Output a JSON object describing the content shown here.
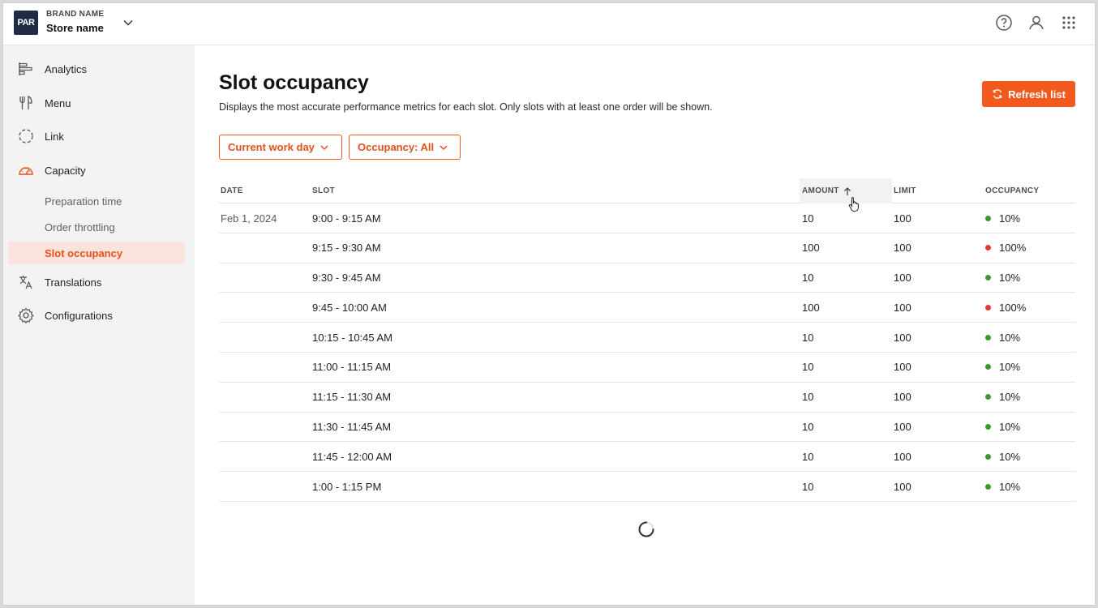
{
  "header": {
    "logo_text": "PAR",
    "brand_label": "BRAND NAME",
    "store_name": "Store name"
  },
  "sidebar": {
    "items": [
      {
        "label": "Analytics",
        "icon": "analytics-icon"
      },
      {
        "label": "Menu",
        "icon": "fork-knife-icon"
      },
      {
        "label": "Link",
        "icon": "link-circle-icon"
      },
      {
        "label": "Capacity",
        "icon": "gauge-icon"
      },
      {
        "label": "Translations",
        "icon": "translate-icon"
      },
      {
        "label": "Configurations",
        "icon": "gear-icon"
      }
    ],
    "capacity_sub": [
      {
        "label": "Preparation time"
      },
      {
        "label": "Order throttling"
      },
      {
        "label": "Slot occupancy"
      }
    ]
  },
  "main": {
    "title": "Slot occupancy",
    "description": "Displays the most accurate performance metrics for each slot. Only slots with at least one order will be shown.",
    "refresh_label": "Refresh list",
    "filters": {
      "date_label": "Current work day",
      "occupancy_label": "Occupancy: All"
    },
    "table": {
      "headers": {
        "date": "DATE",
        "slot": "SLOT",
        "amount": "AMOUNT",
        "limit": "LIMIT",
        "occupancy": "OCCUPANCY"
      },
      "rows": [
        {
          "date": "Feb 1, 2024",
          "slot": "9:00 - 9:15 AM",
          "amount": "10",
          "limit": "100",
          "occupancy": "10%",
          "status": "green"
        },
        {
          "date": "",
          "slot": "9:15 - 9:30 AM",
          "amount": "100",
          "limit": "100",
          "occupancy": "100%",
          "status": "red"
        },
        {
          "date": "",
          "slot": "9:30 - 9:45 AM",
          "amount": "10",
          "limit": "100",
          "occupancy": "10%",
          "status": "green"
        },
        {
          "date": "",
          "slot": "9:45 - 10:00 AM",
          "amount": "100",
          "limit": "100",
          "occupancy": "100%",
          "status": "red"
        },
        {
          "date": "",
          "slot": "10:15 - 10:45 AM",
          "amount": "10",
          "limit": "100",
          "occupancy": "10%",
          "status": "green"
        },
        {
          "date": "",
          "slot": "11:00 - 11:15 AM",
          "amount": "10",
          "limit": "100",
          "occupancy": "10%",
          "status": "green"
        },
        {
          "date": "",
          "slot": "11:15 - 11:30 AM",
          "amount": "10",
          "limit": "100",
          "occupancy": "10%",
          "status": "green"
        },
        {
          "date": "",
          "slot": "11:30 - 11:45 AM",
          "amount": "10",
          "limit": "100",
          "occupancy": "10%",
          "status": "green"
        },
        {
          "date": "",
          "slot": "11:45 - 12:00 AM",
          "amount": "10",
          "limit": "100",
          "occupancy": "10%",
          "status": "green"
        },
        {
          "date": "",
          "slot": "1:00 - 1:15 PM",
          "amount": "10",
          "limit": "100",
          "occupancy": "10%",
          "status": "green"
        }
      ]
    }
  },
  "colors": {
    "accent": "#f25a1d",
    "green": "#3a9a2a",
    "red": "#e53935"
  }
}
